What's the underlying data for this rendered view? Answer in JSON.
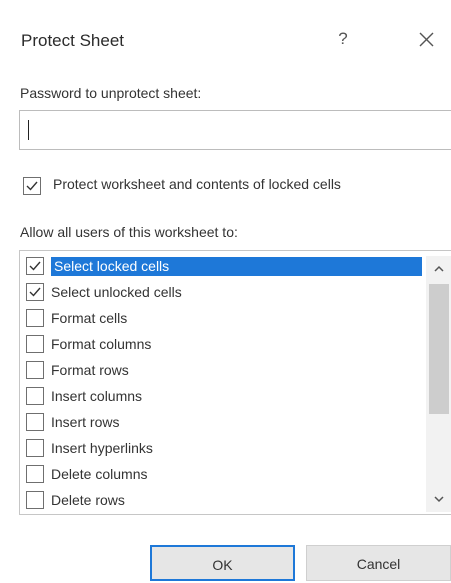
{
  "dialog": {
    "title": "Protect Sheet",
    "help_label": "?",
    "close_icon": "close-icon"
  },
  "password": {
    "label": "Password to unprotect sheet:",
    "value": ""
  },
  "protect_option": {
    "label": "Protect worksheet and contents of locked cells",
    "checked": true
  },
  "allow_label": "Allow all users of this worksheet to:",
  "permissions": [
    {
      "label": "Select locked cells",
      "checked": true,
      "selected": true
    },
    {
      "label": "Select unlocked cells",
      "checked": true,
      "selected": false
    },
    {
      "label": "Format cells",
      "checked": false,
      "selected": false
    },
    {
      "label": "Format columns",
      "checked": false,
      "selected": false
    },
    {
      "label": "Format rows",
      "checked": false,
      "selected": false
    },
    {
      "label": "Insert columns",
      "checked": false,
      "selected": false
    },
    {
      "label": "Insert rows",
      "checked": false,
      "selected": false
    },
    {
      "label": "Insert hyperlinks",
      "checked": false,
      "selected": false
    },
    {
      "label": "Delete columns",
      "checked": false,
      "selected": false
    },
    {
      "label": "Delete rows",
      "checked": false,
      "selected": false
    }
  ],
  "buttons": {
    "ok_label": "OK",
    "cancel_label": "Cancel"
  },
  "colors": {
    "selection": "#1e78d8",
    "ok_border": "#1e78d8"
  }
}
